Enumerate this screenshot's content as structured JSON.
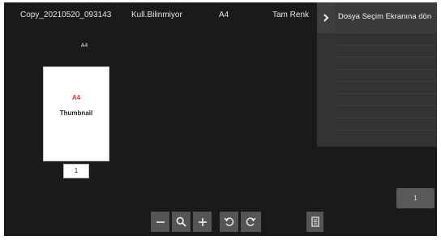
{
  "header": {
    "file_name": "Copy_20210520_093143",
    "user": "Kull.Bilinmiyor",
    "paper_size": "A4",
    "color_mode": "Tam Renk"
  },
  "preview": {
    "size_label": "A4",
    "thumbnail_size_text": "A4",
    "thumbnail_text": "Thumbnail",
    "page_number": "1"
  },
  "right_panel": {
    "back_label": "Dosya Seçim Ekranına dön",
    "arrow_icon": "chevron-right-icon"
  },
  "page_count_button": "1",
  "toolbar": {
    "buttons": [
      "zoom-out-icon",
      "magnifier-icon",
      "zoom-in-icon",
      "rotate-left-icon",
      "rotate-right-icon",
      "list-icon"
    ]
  },
  "colors": {
    "background": "#1a1a1a",
    "panel": "#333333",
    "button": "#555555",
    "accent_red": "#e53935"
  }
}
